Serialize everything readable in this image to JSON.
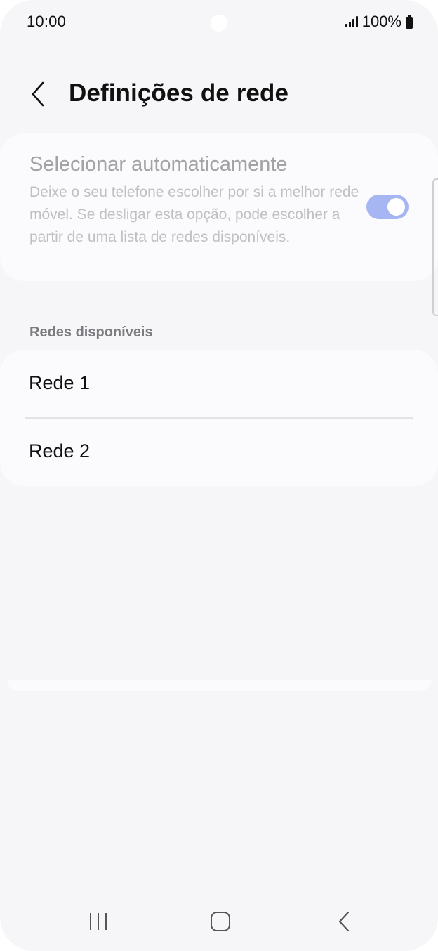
{
  "status_bar": {
    "time": "10:00",
    "battery": "100%",
    "icons": [
      "signal-icon",
      "battery-icon"
    ]
  },
  "header": {
    "title": "Definições de rede",
    "back_icon": "chevron-left-icon"
  },
  "auto_select": {
    "title": "Selecionar automaticamente",
    "description": "Deixe o seu telefone escolher por si a melhor rede móvel. Se desligar esta opção, pode escolher a partir de uma lista de redes disponíveis.",
    "toggle_on": true,
    "toggle_color": "#a5b6f3"
  },
  "networks": {
    "section_title": "Redes disponíveis",
    "items": [
      {
        "label": "Rede 1"
      },
      {
        "label": "Rede 2"
      }
    ]
  },
  "nav_bar": {
    "icons": [
      "recent-apps-icon",
      "home-icon",
      "back-icon"
    ]
  },
  "colors": {
    "background": "#f6f6f8",
    "card": "#fbfbfd",
    "text_primary": "#111111",
    "text_disabled": "#a3a3a7"
  }
}
